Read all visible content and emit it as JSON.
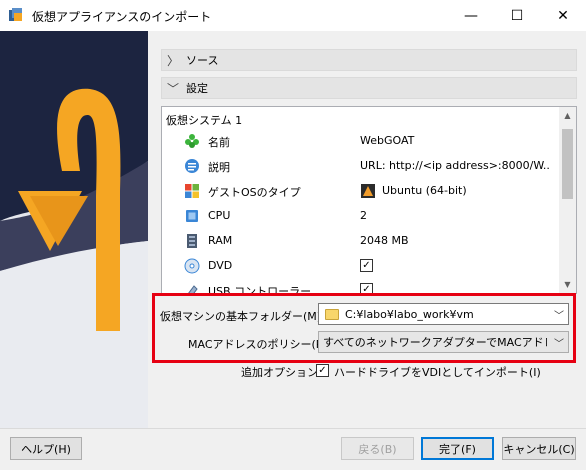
{
  "window": {
    "title": "仮想アプライアンスのインポート",
    "controls": {
      "minimize": "—",
      "maximize": "☐",
      "close": "✕"
    }
  },
  "sections": {
    "source": {
      "label": "ソース",
      "chevron": "〉"
    },
    "settings": {
      "label": "設定",
      "chevron": "﹀"
    }
  },
  "settings_list": {
    "group_title": "仮想システム 1",
    "rows": [
      {
        "name": "名前",
        "value": "WebGOAT",
        "icon": "name-icon"
      },
      {
        "name": "説明",
        "value": "URL: http://<ip address>:8000/W...",
        "icon": "description-icon"
      },
      {
        "name": "ゲストOSのタイプ",
        "value": "Ubuntu (64-bit)",
        "icon": "os-type-icon",
        "value_icon": "ubuntu-icon"
      },
      {
        "name": "CPU",
        "value": "2",
        "icon": "cpu-icon"
      },
      {
        "name": "RAM",
        "value": "2048 MB",
        "icon": "ram-icon"
      },
      {
        "name": "DVD",
        "value": "✓",
        "icon": "dvd-icon"
      },
      {
        "name": "USB コントローラー",
        "value": "✓",
        "icon": "usb-icon"
      }
    ]
  },
  "form": {
    "base_folder_label": "仮想マシンの基本フォルダー(M):",
    "base_folder_value": "C:¥labo¥labo_work¥vm",
    "mac_policy_label": "MACアドレスのポリシー(P):",
    "mac_policy_value": "すべてのネットワークアダプターでMACアドレスを生",
    "additional_options_label": "追加オプション:",
    "import_vdi_label": "ハードドライブをVDIとしてインポート(I)",
    "import_vdi_checked": true
  },
  "buttons": {
    "help": "ヘルプ(H)",
    "back": "戻る(B)",
    "finish": "完了(F)",
    "cancel": "キャンセル(C)"
  },
  "colors": {
    "highlight_border": "#e60012",
    "default_button_border": "#0078d7",
    "arrow": "#f5a623"
  }
}
